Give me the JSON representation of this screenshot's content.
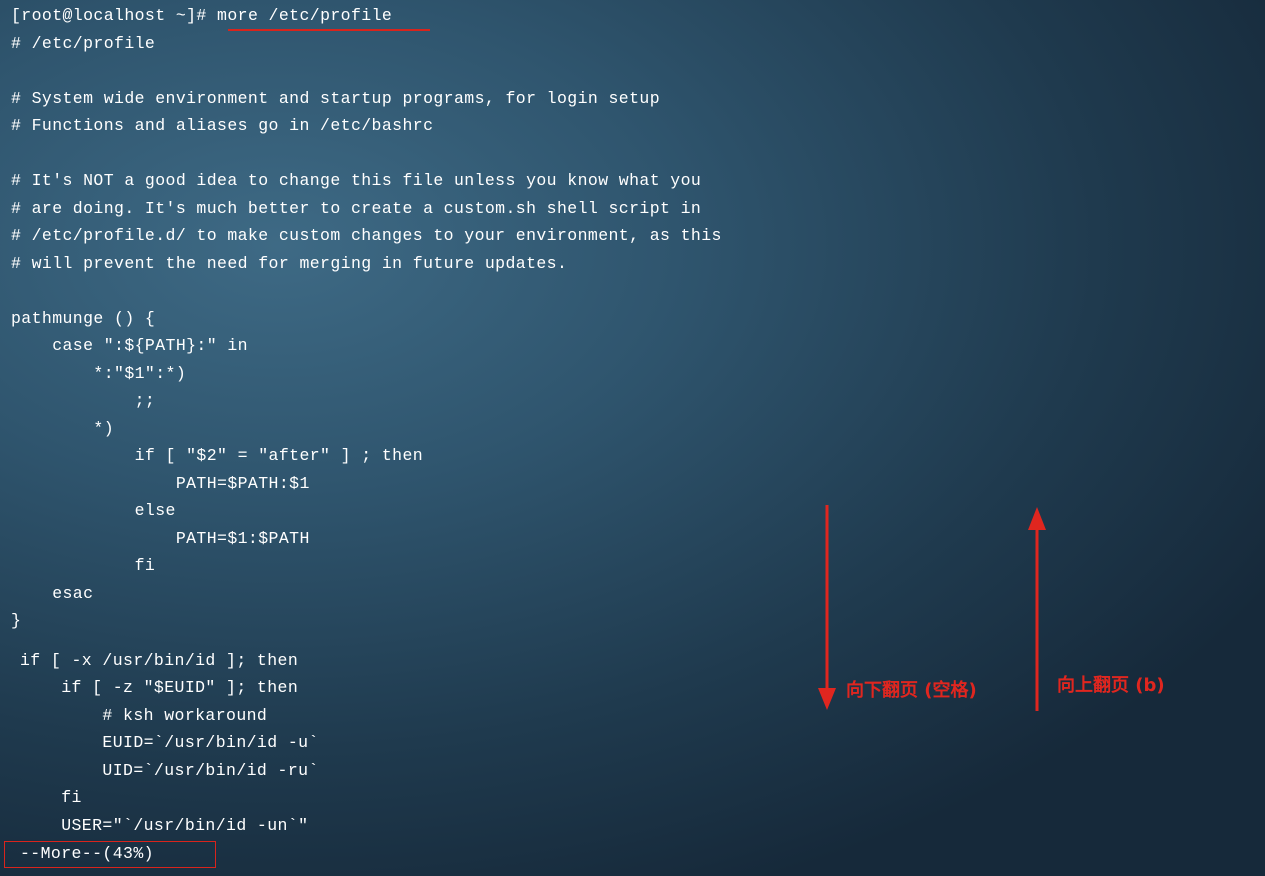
{
  "terminal": {
    "prompt": "[root@localhost ~]#",
    "command": "more /etc/profile",
    "lines": [
      "# /etc/profile",
      "",
      "# System wide environment and startup programs, for login setup",
      "# Functions and aliases go in /etc/bashrc",
      "",
      "# It's NOT a good idea to change this file unless you know what you",
      "# are doing. It's much better to create a custom.sh shell script in",
      "# /etc/profile.d/ to make custom changes to your environment, as this",
      "# will prevent the need for merging in future updates.",
      "",
      "pathmunge () {",
      "    case \":${PATH}:\" in",
      "        *:\"$1\":*)",
      "            ;;",
      "        *)",
      "            if [ \"$2\" = \"after\" ] ; then",
      "                PATH=$PATH:$1",
      "            else",
      "                PATH=$1:$PATH",
      "            fi",
      "    esac",
      "}"
    ],
    "lines2": [
      "if [ -x /usr/bin/id ]; then",
      "    if [ -z \"$EUID\" ]; then",
      "        # ksh workaround",
      "        EUID=`/usr/bin/id -u`",
      "        UID=`/usr/bin/id -ru`",
      "    fi",
      "    USER=\"`/usr/bin/id -un`\""
    ],
    "pager_status": "--More--(43%)"
  },
  "annotations": {
    "page_down": "向下翻页 (空格)",
    "page_up": "向上翻页 (b)",
    "accent_color": "#e0261f"
  }
}
